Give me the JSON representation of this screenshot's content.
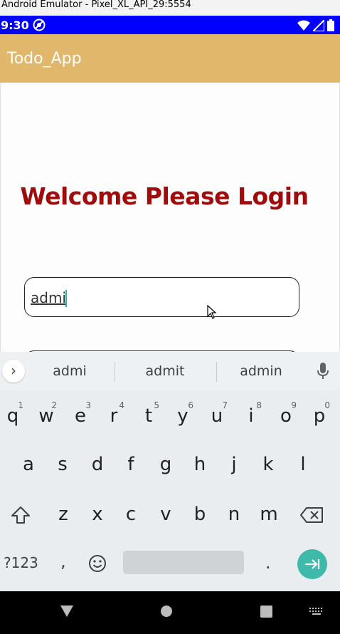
{
  "window": {
    "title": "Android Emulator - Pixel_XL_API_29:5554"
  },
  "status_bar": {
    "time": "9:30"
  },
  "app_bar": {
    "title": "Todo_App"
  },
  "login": {
    "heading": "Welcome Please Login",
    "username_value": "admi"
  },
  "keyboard": {
    "suggestions": [
      "admi",
      "admit",
      "admin"
    ],
    "row1": [
      {
        "key": "q",
        "hint": "1"
      },
      {
        "key": "w",
        "hint": "2"
      },
      {
        "key": "e",
        "hint": "3"
      },
      {
        "key": "r",
        "hint": "4"
      },
      {
        "key": "t",
        "hint": "5"
      },
      {
        "key": "y",
        "hint": "6"
      },
      {
        "key": "u",
        "hint": "7"
      },
      {
        "key": "i",
        "hint": "8"
      },
      {
        "key": "o",
        "hint": "9"
      },
      {
        "key": "p",
        "hint": "0"
      }
    ],
    "row2": [
      "a",
      "s",
      "d",
      "f",
      "g",
      "h",
      "j",
      "k",
      "l"
    ],
    "row3": [
      "z",
      "x",
      "c",
      "v",
      "b",
      "n",
      "m"
    ],
    "symbols_label": "?123",
    "comma": ",",
    "period": "."
  },
  "colors": {
    "status_bar": "#0000ff",
    "app_bar": "#e1b76b",
    "heading": "#a00c0c",
    "accent": "#3fb9a9"
  }
}
